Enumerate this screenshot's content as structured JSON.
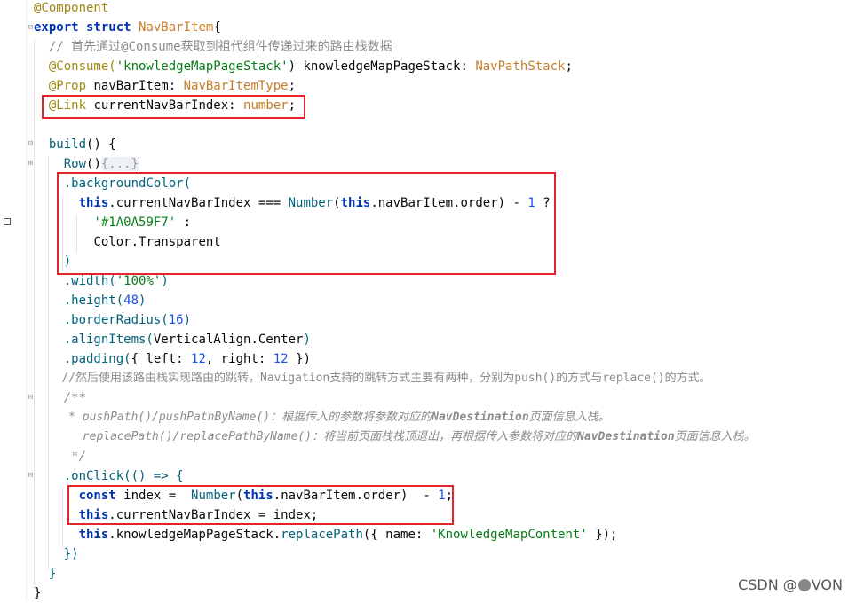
{
  "lines": {
    "l1": "@Component",
    "l2_kw": "export struct",
    "l2_name": "NavBarItem",
    "l2_brace": "{",
    "l3": "// 首先通过@Consume获取到祖代组件传递过来的路由栈数据",
    "l4_ann": "@Consume(",
    "l4_str": "'knowledgeMapPageStack'",
    "l4_rest": ") knowledgeMapPageStack: ",
    "l4_type": "NavPathStack",
    "l4_end": ";",
    "l5_ann": "@Prop",
    "l5_rest": " navBarItem: ",
    "l5_type": "NavBarItemType",
    "l5_end": ";",
    "l6_ann": "@Link",
    "l6_rest": " currentNavBarIndex: ",
    "l6_type": "number",
    "l6_end": ";",
    "l8_fn": "build",
    "l8_rest": "() {",
    "l9_fn": "Row",
    "l9_paren": "()",
    "l9_fold": "{...}",
    "l10_fn": ".backgroundColor(",
    "l11_this": "this",
    "l11_a": ".currentNavBarIndex === ",
    "l11_fn": "Number",
    "l11_b": "(",
    "l11_this2": "this",
    "l11_c": ".navBarItem.order) - ",
    "l11_num": "1",
    "l11_d": " ?",
    "l12_str": "'#1A0A59F7'",
    "l12_rest": " :",
    "l13": "Color.Transparent",
    "l14": ")",
    "l15_fn": ".width(",
    "l15_str": "'100%'",
    "l15_end": ")",
    "l16_fn": ".height(",
    "l16_num": "48",
    "l16_end": ")",
    "l17_fn": ".borderRadius(",
    "l17_num": "16",
    "l17_end": ")",
    "l18_fn": ".alignItems(",
    "l18_rest": "VerticalAlign.Center",
    "l18_end": ")",
    "l19_fn": ".padding(",
    "l19_a": "{ left: ",
    "l19_n1": "12",
    "l19_b": ", right: ",
    "l19_n2": "12",
    "l19_c": " })",
    "l20": "//然后使用该路由栈实现路由的跳转，Navigation支持的跳转方式主要有两种，分别为push()的方式与replace()的方式。",
    "l21": "/**",
    "l22_a": " * pushPath()/pushPathByName()：根据传入的参数将参数对应的",
    "l22_b": "NavDestination",
    "l22_c": "页面信息入栈。",
    "l23_a": "   replacePath()/replacePathByName()：将当前页面栈栈顶退出，再根据传入参数将对应的",
    "l23_b": "NavDestination",
    "l23_c": "页面信息入栈。",
    "l24": " */",
    "l25_fn": ".onClick(",
    "l25_rest": "() => {",
    "l26_kw": "const",
    "l26_a": " index =  ",
    "l26_fn": "Number",
    "l26_b": "(",
    "l26_this": "this",
    "l26_c": ".navBarItem.order)  - ",
    "l26_num": "1",
    "l26_d": ";",
    "l27_this": "this",
    "l27_rest": ".currentNavBarIndex = index;",
    "l28_this": "this",
    "l28_a": ".knowledgeMapPageStack.",
    "l28_fn": "replacePath",
    "l28_b": "({ name: ",
    "l28_str": "'KnowledgeMapContent'",
    "l28_c": " });",
    "l29": "})",
    "l30": "}",
    "l31": "}"
  },
  "watermark": {
    "left": "CSDN @",
    "right": "VON"
  }
}
